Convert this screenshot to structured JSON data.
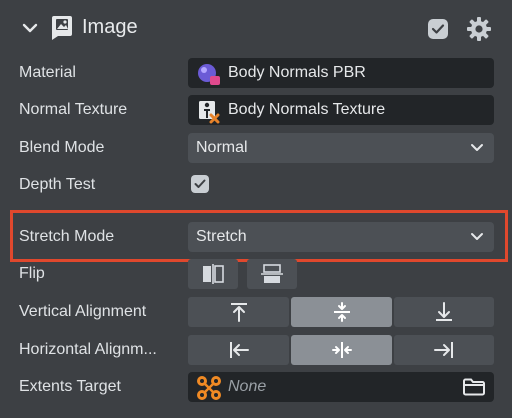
{
  "component": {
    "title": "Image",
    "enabled": true,
    "icons": {
      "collapse": "chevron-down-icon",
      "component": "image-component-icon",
      "settings": "gear-icon"
    }
  },
  "properties": {
    "material": {
      "label": "Material",
      "value": "Body Normals PBR",
      "icon": "material-icon"
    },
    "normal_texture": {
      "label": "Normal Texture",
      "value": "Body Normals Texture",
      "icon": "texture-icon"
    },
    "blend_mode": {
      "label": "Blend Mode",
      "value": "Normal"
    },
    "depth_test": {
      "label": "Depth Test",
      "checked": true
    },
    "stretch_mode": {
      "label": "Stretch Mode",
      "value": "Stretch",
      "highlight_color": "#e0482d"
    },
    "flip": {
      "label": "Flip",
      "options": [
        "flip-horizontal-icon",
        "flip-vertical-icon"
      ]
    },
    "vertical_alignment": {
      "label": "Vertical Alignment",
      "options": [
        "align-top-icon",
        "align-center-vertical-icon",
        "align-bottom-icon"
      ],
      "selected": "align-center-vertical-icon"
    },
    "horizontal_alignment": {
      "label": "Horizontal Alignm...",
      "options": [
        "align-left-icon",
        "align-center-horizontal-icon",
        "align-right-icon"
      ],
      "selected": "align-center-horizontal-icon"
    },
    "extents_target": {
      "label": "Extents Target",
      "value": "None",
      "icon": "extents-icon",
      "browse_icon": "folder-icon"
    }
  }
}
